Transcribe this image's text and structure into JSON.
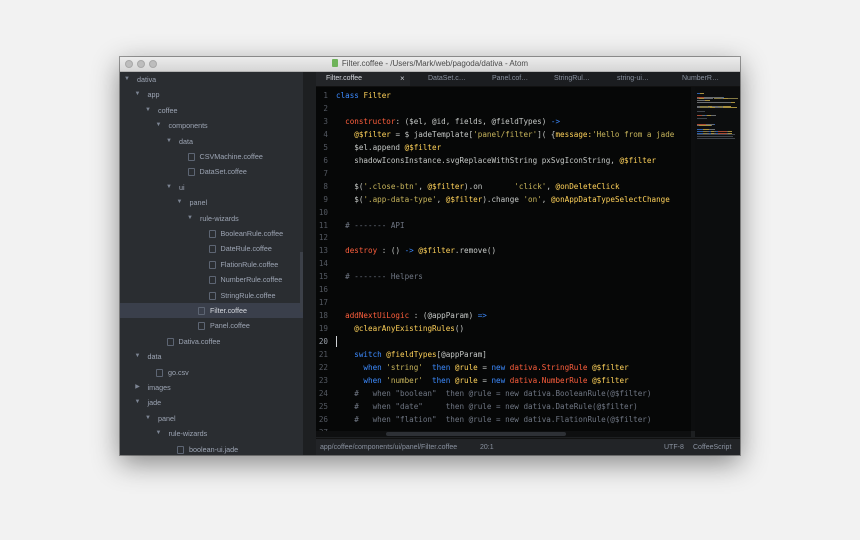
{
  "window": {
    "title": "Filter.coffee - /Users/Mark/web/pagoda/dativa - Atom"
  },
  "tree": {
    "items": [
      {
        "label": "dativa",
        "type": "folder",
        "expanded": true,
        "depth": 0
      },
      {
        "label": "app",
        "type": "folder",
        "expanded": true,
        "depth": 1
      },
      {
        "label": "coffee",
        "type": "folder",
        "expanded": true,
        "depth": 2
      },
      {
        "label": "components",
        "type": "folder",
        "expanded": true,
        "depth": 3
      },
      {
        "label": "data",
        "type": "folder",
        "expanded": true,
        "depth": 4
      },
      {
        "label": "CSVMachine.coffee",
        "type": "file",
        "depth": 5
      },
      {
        "label": "DataSet.coffee",
        "type": "file",
        "depth": 5
      },
      {
        "label": "ui",
        "type": "folder",
        "expanded": true,
        "depth": 4
      },
      {
        "label": "panel",
        "type": "folder",
        "expanded": true,
        "depth": 5
      },
      {
        "label": "rule-wizards",
        "type": "folder",
        "expanded": true,
        "depth": 6
      },
      {
        "label": "BooleanRule.coffee",
        "type": "file",
        "depth": 7
      },
      {
        "label": "DateRule.coffee",
        "type": "file",
        "depth": 7
      },
      {
        "label": "FlationRule.coffee",
        "type": "file",
        "depth": 7
      },
      {
        "label": "NumberRule.coffee",
        "type": "file",
        "depth": 7
      },
      {
        "label": "StringRule.coffee",
        "type": "file",
        "depth": 7
      },
      {
        "label": "Filter.coffee",
        "type": "file",
        "depth": 6,
        "selected": true
      },
      {
        "label": "Panel.coffee",
        "type": "file",
        "depth": 6
      },
      {
        "label": "Dativa.coffee",
        "type": "file",
        "depth": 3
      },
      {
        "label": "data",
        "type": "folder",
        "expanded": true,
        "depth": 1
      },
      {
        "label": "go.csv",
        "type": "file",
        "depth": 2
      },
      {
        "label": "images",
        "type": "folder",
        "expanded": false,
        "depth": 1
      },
      {
        "label": "jade",
        "type": "folder",
        "expanded": true,
        "depth": 1
      },
      {
        "label": "panel",
        "type": "folder",
        "expanded": true,
        "depth": 2
      },
      {
        "label": "rule-wizards",
        "type": "folder",
        "expanded": true,
        "depth": 3
      },
      {
        "label": "boolean-ui.jade",
        "type": "file",
        "depth": 4
      }
    ]
  },
  "tabs": [
    {
      "label": "Filter.coffee",
      "active": true,
      "close": "×"
    },
    {
      "label": "DataSet.c…"
    },
    {
      "label": "Panel.cof…"
    },
    {
      "label": "StringRul…"
    },
    {
      "label": "string-ui…"
    },
    {
      "label": "NumberR…"
    }
  ],
  "editor": {
    "active_line": 20,
    "lines": [
      {
        "n": "1",
        "tokens": [
          [
            "class ",
            "k-blue"
          ],
          [
            "Filter",
            "k-yel"
          ]
        ]
      },
      {
        "n": "2",
        "tokens": []
      },
      {
        "n": "3",
        "tokens": [
          [
            "  constructor",
            "k-red"
          ],
          [
            ": ($el, @id, fields, @fieldTypes) ",
            "k-plain"
          ],
          [
            "->",
            "k-blue"
          ]
        ]
      },
      {
        "n": "4",
        "tokens": [
          [
            "    ",
            "k-plain"
          ],
          [
            "@$filter",
            "k-yel"
          ],
          [
            " = $ jadeTemplate[",
            "k-plain"
          ],
          [
            "'panel/filter'",
            "k-str"
          ],
          [
            "]( {",
            "k-plain"
          ],
          [
            "message:",
            "k-yel"
          ],
          [
            "'Hello from a jade",
            "k-str"
          ]
        ]
      },
      {
        "n": "5",
        "tokens": [
          [
            "    $el.append ",
            "k-plain"
          ],
          [
            "@$filter",
            "k-yel"
          ]
        ]
      },
      {
        "n": "6",
        "tokens": [
          [
            "    shadowIconsInstance.svgReplaceWithString pxSvgIconString, ",
            "k-plain"
          ],
          [
            "@$filter",
            "k-yel"
          ]
        ]
      },
      {
        "n": "7",
        "tokens": []
      },
      {
        "n": "8",
        "tokens": [
          [
            "    $(",
            "k-plain"
          ],
          [
            "'.close-btn'",
            "k-str"
          ],
          [
            ", ",
            "k-plain"
          ],
          [
            "@$filter",
            "k-yel"
          ],
          [
            ").on       ",
            "k-plain"
          ],
          [
            "'click'",
            "k-str"
          ],
          [
            ", ",
            "k-plain"
          ],
          [
            "@onDeleteClick",
            "k-yel"
          ]
        ]
      },
      {
        "n": "9",
        "tokens": [
          [
            "    $(",
            "k-plain"
          ],
          [
            "'.app-data-type'",
            "k-str"
          ],
          [
            ", ",
            "k-plain"
          ],
          [
            "@$filter",
            "k-yel"
          ],
          [
            ").change ",
            "k-plain"
          ],
          [
            "'on'",
            "k-str"
          ],
          [
            ", ",
            "k-plain"
          ],
          [
            "@onAppDataTypeSelectChange",
            "k-yel"
          ]
        ]
      },
      {
        "n": "10",
        "tokens": []
      },
      {
        "n": "11",
        "tokens": [
          [
            "  # ------- API",
            "k-cmt"
          ]
        ]
      },
      {
        "n": "12",
        "tokens": []
      },
      {
        "n": "13",
        "tokens": [
          [
            "  destroy",
            "k-red"
          ],
          [
            " : () ",
            "k-plain"
          ],
          [
            "->",
            "k-blue"
          ],
          [
            " ",
            "k-plain"
          ],
          [
            "@$filter",
            "k-yel"
          ],
          [
            ".remove()",
            "k-plain"
          ]
        ]
      },
      {
        "n": "14",
        "tokens": []
      },
      {
        "n": "15",
        "tokens": [
          [
            "  # ------- Helpers",
            "k-cmt"
          ]
        ]
      },
      {
        "n": "16",
        "tokens": []
      },
      {
        "n": "17",
        "tokens": []
      },
      {
        "n": "18",
        "tokens": [
          [
            "  addNextUiLogic",
            "k-red"
          ],
          [
            " : (@appParam) ",
            "k-plain"
          ],
          [
            "=>",
            "k-blue"
          ]
        ]
      },
      {
        "n": "19",
        "tokens": [
          [
            "    ",
            "k-plain"
          ],
          [
            "@clearAnyExistingRules",
            "k-yel"
          ],
          [
            "()",
            "k-plain"
          ]
        ]
      },
      {
        "n": "20",
        "tokens": []
      },
      {
        "n": "21",
        "tokens": [
          [
            "    switch ",
            "k-blue"
          ],
          [
            "@fieldTypes",
            "k-yel"
          ],
          [
            "[@appParam]",
            "k-plain"
          ]
        ]
      },
      {
        "n": "22",
        "tokens": [
          [
            "      when ",
            "k-blue"
          ],
          [
            "'string'",
            "k-str"
          ],
          [
            "  ",
            "k-plain"
          ],
          [
            "then ",
            "k-blue"
          ],
          [
            "@rule",
            "k-yel"
          ],
          [
            " = ",
            "k-plain"
          ],
          [
            "new ",
            "k-blue"
          ],
          [
            "dativa.StringRule",
            "k-red"
          ],
          [
            " ",
            "k-plain"
          ],
          [
            "@$filter",
            "k-yel"
          ]
        ]
      },
      {
        "n": "23",
        "tokens": [
          [
            "      when ",
            "k-blue"
          ],
          [
            "'number'",
            "k-str"
          ],
          [
            "  ",
            "k-plain"
          ],
          [
            "then ",
            "k-blue"
          ],
          [
            "@rule",
            "k-yel"
          ],
          [
            " = ",
            "k-plain"
          ],
          [
            "new ",
            "k-blue"
          ],
          [
            "dativa.NumberRule",
            "k-red"
          ],
          [
            " ",
            "k-plain"
          ],
          [
            "@$filter",
            "k-yel"
          ]
        ]
      },
      {
        "n": "24",
        "tokens": [
          [
            "    #   when \"boolean\"  then @rule = new dativa.BooleanRule(@$filter)",
            "k-cmt"
          ]
        ]
      },
      {
        "n": "25",
        "tokens": [
          [
            "    #   when \"date\"     then @rule = new dativa.DateRule(@$filter)",
            "k-cmt"
          ]
        ]
      },
      {
        "n": "26",
        "tokens": [
          [
            "    #   when \"flation\"  then @rule = new dativa.FlationRule(@$filter)",
            "k-cmt"
          ]
        ]
      },
      {
        "n": "27",
        "tokens": []
      }
    ]
  },
  "status": {
    "path": "app/coffee/components/ui/panel/Filter.coffee",
    "position": "20:1",
    "encoding": "UTF-8",
    "grammar": "CoffeeScript"
  },
  "colors": {
    "keyword": "#3d8bff",
    "entity": "#ff5f3d",
    "variable": "#ffd25a",
    "string": "#c9b65c",
    "comment": "#6f7683"
  }
}
